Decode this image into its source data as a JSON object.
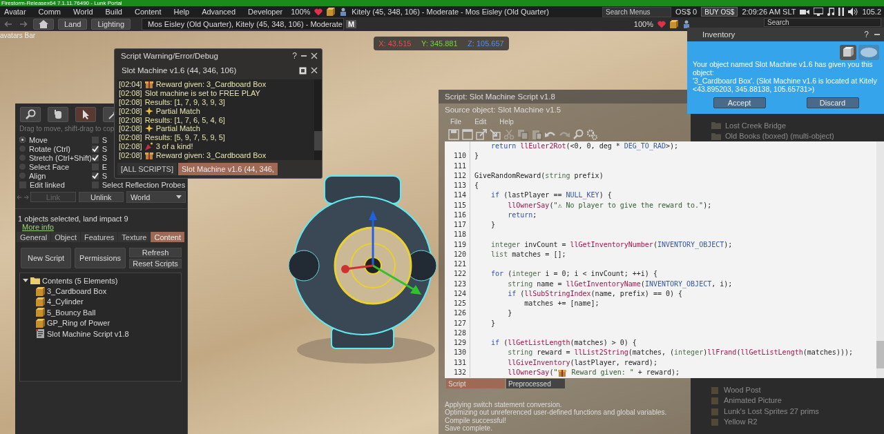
{
  "title_bar": {
    "title": "Firestorm-Releasex64 7.1.11.76490 - Lunk Portal"
  },
  "menu_bar": {
    "items": [
      "Avatar",
      "Comm",
      "World",
      "Build",
      "Content",
      "Help",
      "Advanced",
      "Developer"
    ],
    "volume": "100%",
    "location": "Kitely (45, 348, 106) - Moderate - Mos Eisley (Old Quarter)",
    "search_placeholder": "Search Menus",
    "balance": "OS$ 0",
    "buy_button": "BUY OS$",
    "time": "2:09:26 AM SLT",
    "fps": "105.2"
  },
  "nav_bar": {
    "buttons": [
      "Land",
      "Lighting"
    ],
    "location": "Mos Eisley (Old Quarter), Kitely (45, 348, 106) - Moderate",
    "maturity": "M",
    "zoom": "100%",
    "search_placeholder": "Search"
  },
  "scene": {
    "overlay_label": "avatars Bar",
    "coordinates": [
      {
        "label": "X: 43.515",
        "color": "#e05050"
      },
      {
        "label": "Y: 345.881",
        "color": "#7ad040"
      },
      {
        "label": "Z: 105.657",
        "color": "#5a8cf0"
      }
    ]
  },
  "debug_window": {
    "title": "Script Warning/Error/Debug",
    "help": "?",
    "object": "Slot Machine v1.6 (44, 346, 106)",
    "log": [
      {
        "time": "[02:04]",
        "kind": "gift",
        "text": "Reward given: 3_Cardboard Box"
      },
      {
        "time": "[02:08]",
        "kind": "text",
        "text": "Slot machine is set to FREE PLAY"
      },
      {
        "time": "[02:08]",
        "kind": "text",
        "text": "Results: [1, 7, 9, 3, 9, 3]"
      },
      {
        "time": "[02:08]",
        "kind": "sparkle",
        "text": "Partial Match"
      },
      {
        "time": "[02:08]",
        "kind": "text",
        "text": "Results: [1, 7, 6, 5, 4, 6]"
      },
      {
        "time": "[02:08]",
        "kind": "sparkle",
        "text": "Partial Match"
      },
      {
        "time": "[02:08]",
        "kind": "text",
        "text": "Results: [5, 9, 7, 5, 9, 5]"
      },
      {
        "time": "[02:08]",
        "kind": "popper",
        "text": "3 of a kind!"
      },
      {
        "time": "[02:08]",
        "kind": "gift",
        "text": "Reward given: 3_Cardboard Box"
      }
    ],
    "tabs": [
      {
        "label": "[ALL SCRIPTS]",
        "selected": false
      },
      {
        "label": "Slot Machine v1.6 (44, 346,",
        "selected": true
      }
    ]
  },
  "build_panel": {
    "tools": [
      {
        "kind": "zoom",
        "selected": false
      },
      {
        "kind": "grab",
        "selected": false
      },
      {
        "kind": "select",
        "selected": true
      },
      {
        "kind": "create",
        "selected": false
      }
    ],
    "hint": "Drag to move, shift-drag to cop",
    "modes": [
      {
        "label": "Move",
        "selected": true
      },
      {
        "label": "Rotate (Ctrl)",
        "selected": false
      },
      {
        "label": "Stretch (Ctrl+Shift)",
        "selected": false
      },
      {
        "label": "Select Face",
        "selected": false
      },
      {
        "label": "Align",
        "selected": false
      }
    ],
    "edit_linked": {
      "label": "Edit linked",
      "checked": false
    },
    "options": [
      {
        "label": "S",
        "checked": false
      },
      {
        "label": "S",
        "checked": true
      },
      {
        "label": "S",
        "checked": true
      },
      {
        "label": "E",
        "checked": false
      },
      {
        "label": "S",
        "checked": true
      },
      {
        "label": "Select Reflection Probes",
        "checked": false
      }
    ],
    "link_buttons": [
      {
        "label": "Link",
        "disabled": true
      },
      {
        "label": "Unlink",
        "disabled": false
      }
    ],
    "dropdown": "World",
    "selection_info": "1 objects selected, land impact 9",
    "more_info": "More info",
    "tabs": [
      {
        "label": "General",
        "selected": false
      },
      {
        "label": "Object",
        "selected": false
      },
      {
        "label": "Features",
        "selected": false
      },
      {
        "label": "Texture",
        "selected": false
      },
      {
        "label": "Content",
        "selected": true
      }
    ],
    "buttons": [
      "New Script",
      "Permissions",
      "Refresh",
      "Reset Scripts"
    ],
    "tree": {
      "label": "Contents (5 Elements)",
      "expanded": true,
      "children": [
        {
          "label": "3_Cardboard Box",
          "kind": "object"
        },
        {
          "label": "4_Cylinder",
          "kind": "object"
        },
        {
          "label": "5_Bouncy Ball",
          "kind": "object"
        },
        {
          "label": "GP_Ring of Power",
          "kind": "object"
        },
        {
          "label": "Slot Machine Script v1.8",
          "kind": "script"
        }
      ]
    }
  },
  "inventory_panel": {
    "folders": [
      {
        "label": "Lost Creek Bridge"
      },
      {
        "label": "Old Books (boxed) (multi-object)"
      }
    ],
    "objects": [
      {
        "label": "Wood Post"
      },
      {
        "label": "Animated Picture"
      },
      {
        "label": "Lunk's Lost Sprites 27 prims"
      },
      {
        "label": "Yellow R2"
      }
    ]
  },
  "script_editor": {
    "title": "Script: Slot Machine Script v1.8",
    "source": "Source object: Slot Machine v1.5",
    "menu": [
      "File",
      "Edit",
      "Help"
    ],
    "toolbar": [
      {
        "kind": "save",
        "disabled": false
      },
      {
        "kind": "window",
        "disabled": false
      },
      {
        "kind": "export",
        "disabled": false
      },
      {
        "kind": "import",
        "disabled": false
      },
      {
        "kind": "cut",
        "disabled": true
      },
      {
        "kind": "copy",
        "disabled": true
      },
      {
        "kind": "paste",
        "disabled": true
      },
      {
        "kind": "undo",
        "disabled": false
      },
      {
        "kind": "redo",
        "disabled": true
      },
      {
        "kind": "search",
        "disabled": false
      },
      {
        "kind": "settings",
        "disabled": false
      }
    ],
    "code": [
      {
        "tokens": [
          {
            "kind": "keyword",
            "text": "    return "
          },
          {
            "kind": "func",
            "text": "llEuler2Rot"
          },
          {
            "kind": "plain",
            "text": "(<0, 0, deg * "
          },
          {
            "kind": "const",
            "text": "DEG_TO_RAD"
          },
          {
            "kind": "plain",
            "text": ">);"
          }
        ]
      },
      {
        "number": "110",
        "tokens": [
          {
            "kind": "plain",
            "text": "}"
          }
        ]
      },
      {
        "number": "111"
      },
      {
        "number": "112",
        "tokens": [
          {
            "kind": "plain",
            "text": "GiveRandomReward("
          },
          {
            "kind": "type",
            "text": "string"
          },
          {
            "kind": "plain",
            "text": " prefix)"
          }
        ]
      },
      {
        "number": "113",
        "tokens": [
          {
            "kind": "plain",
            "text": "{"
          }
        ]
      },
      {
        "number": "114",
        "tokens": [
          {
            "kind": "keyword",
            "text": "    if"
          },
          {
            "kind": "plain",
            "text": " (lastPlayer == "
          },
          {
            "kind": "const",
            "text": "NULL_KEY"
          },
          {
            "kind": "plain",
            "text": ") {"
          }
        ]
      },
      {
        "number": "115",
        "tokens": [
          {
            "kind": "func",
            "text": "        llOwnerSay"
          },
          {
            "kind": "plain",
            "text": "("
          },
          {
            "kind": "string",
            "text": "\"⚠ No player to give the reward to.\""
          },
          {
            "kind": "plain",
            "text": ");"
          }
        ]
      },
      {
        "number": "116",
        "tokens": [
          {
            "kind": "keyword",
            "text": "        return"
          },
          {
            "kind": "plain",
            "text": ";"
          }
        ]
      },
      {
        "number": "117",
        "tokens": [
          {
            "kind": "plain",
            "text": "    }"
          }
        ]
      },
      {
        "number": "118"
      },
      {
        "number": "119",
        "tokens": [
          {
            "kind": "type",
            "text": "    integer"
          },
          {
            "kind": "plain",
            "text": " invCount = "
          },
          {
            "kind": "func",
            "text": "llGetInventoryNumber"
          },
          {
            "kind": "plain",
            "text": "("
          },
          {
            "kind": "const",
            "text": "INVENTORY_OBJECT"
          },
          {
            "kind": "plain",
            "text": ");"
          }
        ]
      },
      {
        "number": "120",
        "tokens": [
          {
            "kind": "type",
            "text": "    list"
          },
          {
            "kind": "plain",
            "text": " matches = [];"
          }
        ]
      },
      {
        "number": "121"
      },
      {
        "number": "122",
        "tokens": [
          {
            "kind": "keyword",
            "text": "    for"
          },
          {
            "kind": "plain",
            "text": " ("
          },
          {
            "kind": "type",
            "text": "integer"
          },
          {
            "kind": "plain",
            "text": " i = 0; i < invCount; ++i) {"
          }
        ]
      },
      {
        "number": "123",
        "tokens": [
          {
            "kind": "type",
            "text": "        string"
          },
          {
            "kind": "plain",
            "text": " name = "
          },
          {
            "kind": "func",
            "text": "llGetInventoryName"
          },
          {
            "kind": "plain",
            "text": "("
          },
          {
            "kind": "const",
            "text": "INVENTORY_OBJECT"
          },
          {
            "kind": "plain",
            "text": ", i);"
          }
        ]
      },
      {
        "number": "124",
        "tokens": [
          {
            "kind": "keyword",
            "text": "        if"
          },
          {
            "kind": "plain",
            "text": " ("
          },
          {
            "kind": "func",
            "text": "llSubStringIndex"
          },
          {
            "kind": "plain",
            "text": "(name, prefix) == 0) {"
          }
        ]
      },
      {
        "number": "125",
        "tokens": [
          {
            "kind": "plain",
            "text": "            matches += [name];"
          }
        ]
      },
      {
        "number": "126",
        "tokens": [
          {
            "kind": "plain",
            "text": "        }"
          }
        ]
      },
      {
        "number": "127",
        "tokens": [
          {
            "kind": "plain",
            "text": "    }"
          }
        ]
      },
      {
        "number": "128"
      },
      {
        "number": "129",
        "tokens": [
          {
            "kind": "keyword",
            "text": "    if"
          },
          {
            "kind": "plain",
            "text": " ("
          },
          {
            "kind": "func",
            "text": "llGetListLength"
          },
          {
            "kind": "plain",
            "text": "(matches) > 0) {"
          }
        ]
      },
      {
        "number": "130",
        "tokens": [
          {
            "kind": "type",
            "text": "        string"
          },
          {
            "kind": "plain",
            "text": " reward = "
          },
          {
            "kind": "func",
            "text": "llList2String"
          },
          {
            "kind": "plain",
            "text": "(matches, ("
          },
          {
            "kind": "type",
            "text": "integer"
          },
          {
            "kind": "plain",
            "text": ")"
          },
          {
            "kind": "func",
            "text": "llFrand"
          },
          {
            "kind": "plain",
            "text": "("
          },
          {
            "kind": "func",
            "text": "llGetListLength"
          },
          {
            "kind": "plain",
            "text": "(matches)));"
          }
        ]
      },
      {
        "number": "131",
        "tokens": [
          {
            "kind": "func",
            "text": "        llGiveInventory"
          },
          {
            "kind": "plain",
            "text": "(lastPlayer, reward);"
          }
        ]
      },
      {
        "number": "132",
        "tokens": [
          {
            "kind": "func",
            "text": "        llOwnerSay"
          },
          {
            "kind": "plain",
            "text": "("
          },
          {
            "kind": "string",
            "text": "\""
          },
          {
            "kind": "gift"
          },
          {
            "kind": "string",
            "text": " Reward given: \""
          },
          {
            "kind": "plain",
            "text": " + reward);"
          }
        ]
      }
    ],
    "tabs": [
      {
        "label": "Script",
        "selected": true
      },
      {
        "label": "Preprocessed",
        "selected": false
      }
    ],
    "output": [
      "Applying switch statement conversion.",
      "Optimizing out unreferenced user-defined functions and global variables.",
      "Compile successful!",
      "Save complete."
    ]
  },
  "notification": {
    "title": "Inventory",
    "help": "?",
    "message": [
      "Your object named Slot Machine v1.6 has given you this object:",
      "'3_Cardboard Box'. (Slot Machine v1.6 is located at Kitely <43.895203, 345.88138, 105.65731>)"
    ],
    "buttons": [
      "Accept",
      "Discard"
    ]
  }
}
